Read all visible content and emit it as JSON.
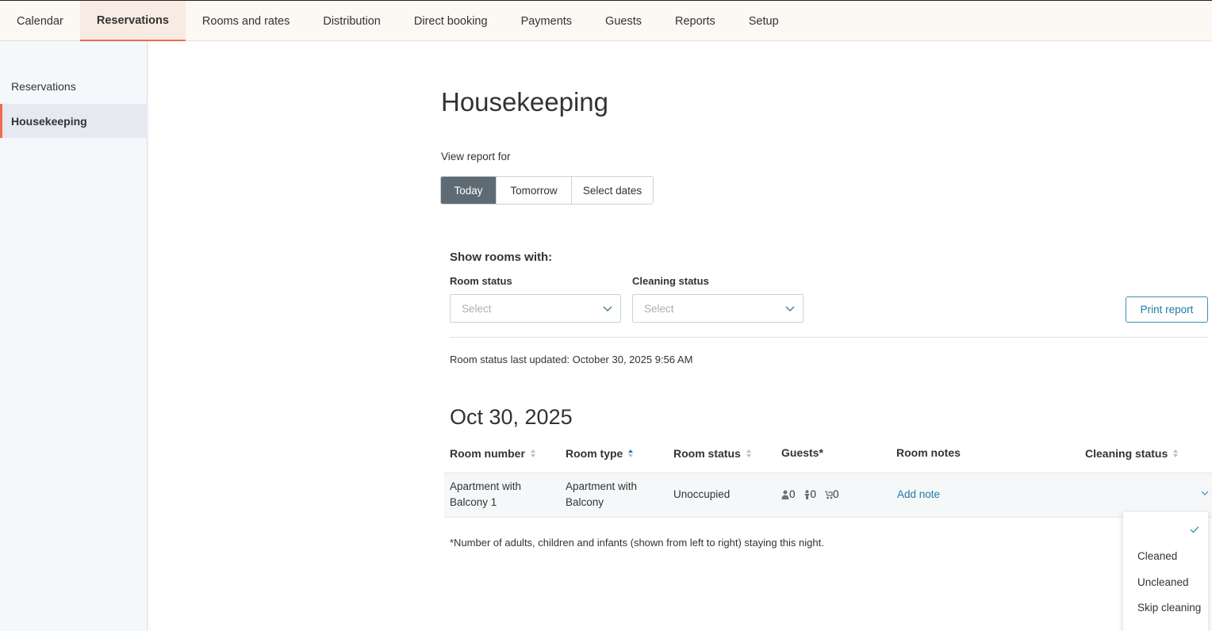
{
  "topnav": {
    "tabs": [
      {
        "label": "Calendar"
      },
      {
        "label": "Reservations"
      },
      {
        "label": "Rooms and rates"
      },
      {
        "label": "Distribution"
      },
      {
        "label": "Direct booking"
      },
      {
        "label": "Payments"
      },
      {
        "label": "Guests"
      },
      {
        "label": "Reports"
      },
      {
        "label": "Setup"
      }
    ],
    "active": "Reservations"
  },
  "sidebar": {
    "items": [
      {
        "label": "Reservations"
      },
      {
        "label": "Housekeeping"
      }
    ],
    "active": "Housekeeping"
  },
  "page": {
    "title": "Housekeeping",
    "view_report_label": "View report for",
    "segments": [
      {
        "label": "Today"
      },
      {
        "label": "Tomorrow"
      },
      {
        "label": "Select dates"
      }
    ],
    "active_segment": "Today"
  },
  "filters": {
    "heading": "Show rooms with:",
    "room_status": {
      "label": "Room status",
      "placeholder": "Select"
    },
    "cleaning_status": {
      "label": "Cleaning status",
      "placeholder": "Select"
    },
    "print_label": "Print report"
  },
  "last_updated": "Room status last updated: October 30, 2025 9:56 AM",
  "report": {
    "date": "Oct 30, 2025",
    "columns": [
      {
        "label": "Room number",
        "sort": "none"
      },
      {
        "label": "Room type",
        "sort": "ascending"
      },
      {
        "label": "Room status",
        "sort": "none"
      },
      {
        "label": "Guests*"
      },
      {
        "label": "Room notes"
      },
      {
        "label": "Cleaning status",
        "sort": "none"
      }
    ],
    "rows": [
      {
        "room_number": "Apartment with Balcony 1",
        "room_type": "Apartment with Balcony",
        "room_status": "Unoccupied",
        "adults": "0",
        "children": "0",
        "infants": "0",
        "notes_link": "Add note"
      }
    ],
    "footnote": "*Number of adults, children and infants (shown from left to right) staying this night."
  },
  "cleaning_dropdown": {
    "options": [
      {
        "label": "Cleaned"
      },
      {
        "label": "Uncleaned"
      },
      {
        "label": "Skip cleaning"
      }
    ]
  },
  "colors": {
    "accent": "#f26b4d",
    "link": "#1e7aa8",
    "segment_active": "#5f6b74",
    "sort_active": "#1e7aa8"
  }
}
